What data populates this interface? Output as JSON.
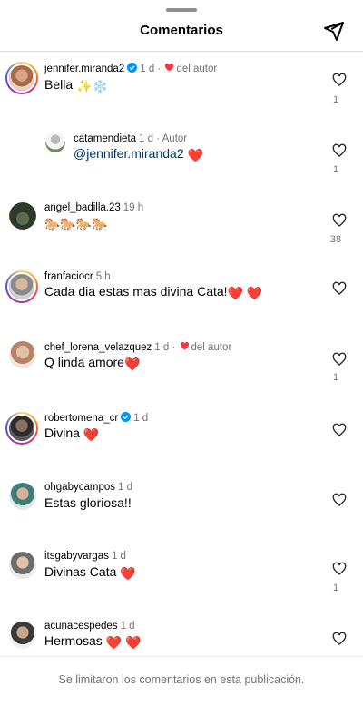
{
  "header": {
    "title": "Comentarios",
    "send_icon": "paper-plane-icon"
  },
  "comments": [
    {
      "user": "jennifer.miranda2",
      "verified": true,
      "time": "1 d",
      "liked_by_author": "del autor",
      "text": "Bella",
      "emoji": "✨❄️",
      "likes": "1"
    },
    {
      "user": "catamendieta",
      "verified": false,
      "time": "1 d",
      "author_tag": "Autor",
      "mention": "@jennifer.miranda2",
      "emoji": "❤️",
      "likes": "1"
    },
    {
      "user": "angel_badilla.23",
      "verified": false,
      "time": "19 h",
      "emoji": "🐎🐎🐎🐎",
      "likes": "38"
    },
    {
      "user": "franfaciocr",
      "verified": false,
      "time": "5 h",
      "text": "Cada dia estas mas divina Cata!",
      "emoji": "❤️ ❤️",
      "likes": ""
    },
    {
      "user": "chef_lorena_velazquez",
      "verified": false,
      "time": "1 d",
      "liked_by_author": "del autor",
      "text": "Q linda amore",
      "emoji": "❤️",
      "likes": "1"
    },
    {
      "user": "robertomena_cr",
      "verified": true,
      "time": "1 d",
      "text": "Divina",
      "emoji": "❤️",
      "likes": ""
    },
    {
      "user": "ohgabycampos",
      "verified": false,
      "time": "1 d",
      "text": "Estas gloriosa!!",
      "likes": ""
    },
    {
      "user": "itsgabyvargas",
      "verified": false,
      "time": "1 d",
      "text": "Divinas Cata",
      "emoji": "❤️",
      "likes": "1"
    },
    {
      "user": "acunacespedes",
      "verified": false,
      "time": "1 d",
      "text": "Hermosas",
      "emoji": "❤️ ❤️",
      "likes": ""
    }
  ],
  "footer": {
    "notice": "Se limitaron los comentarios en esta publicación."
  },
  "colors": {
    "accent_link": "#00376b",
    "verified_blue": "#0095f6",
    "heart_red": "#ff3040",
    "muted": "#737373"
  }
}
